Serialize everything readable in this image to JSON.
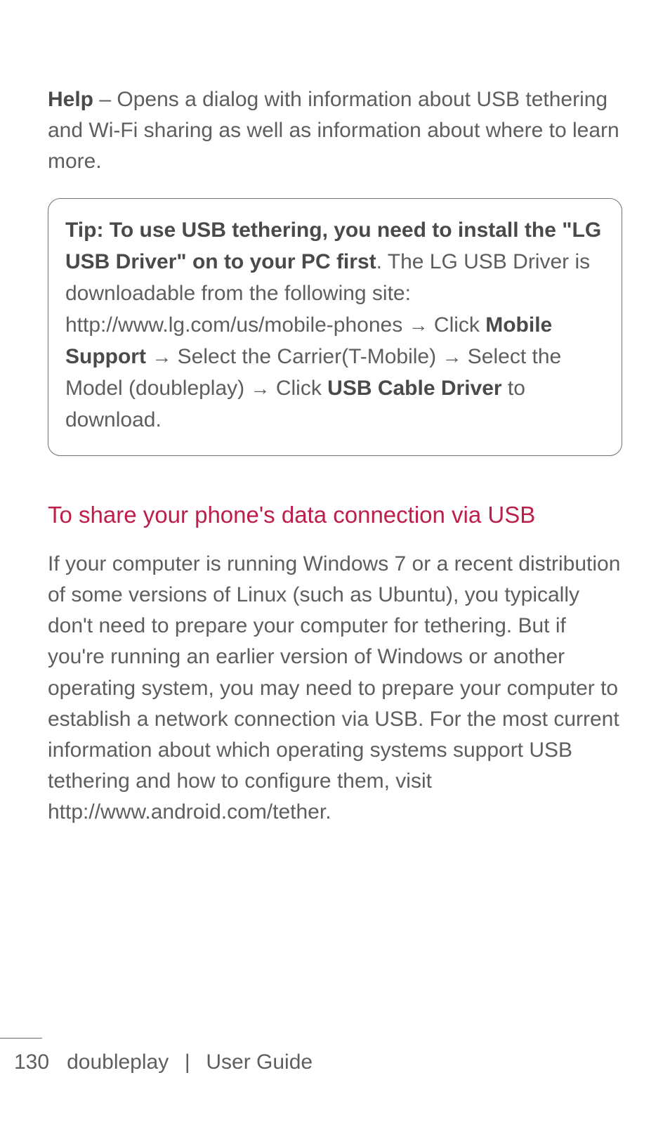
{
  "help": {
    "label": "Help",
    "dash": " – ",
    "text": "Opens a dialog with information about USB tethering and Wi-Fi sharing as well as information about where to learn more."
  },
  "tip": {
    "bold_intro": "Tip: To use USB tethering, you need to install the \"LG USB Driver\" on to your PC first",
    "after_intro": ". The LG USB Driver is downloadable from the following site: http://www.lg.com/us/mobile-phones ",
    "click1": " Click ",
    "mobile_support": "Mobile Support",
    "select_carrier": " Select the Carrier(T-Mobile) ",
    "select_model": " Select the Model (doubleplay) ",
    "click2": " Click ",
    "usb_cable_driver": "USB Cable Driver",
    "to_download": " to download."
  },
  "arrow_glyph": "→",
  "section": {
    "heading": "To share your phone's data connection via USB",
    "body": "If your computer is running Windows 7 or a recent distribution of some versions of Linux (such as Ubuntu), you typically don't need to prepare your computer for tethering. But if you're running an earlier version of Windows or another operating system, you may need to prepare your computer to establish a network connection via USB. For the most current information about which operating systems support USB tethering and how to configure them, visit http://www.android.com/tether."
  },
  "footer": {
    "page": "130",
    "product": "doubleplay",
    "separator": "|",
    "title": "User Guide"
  }
}
